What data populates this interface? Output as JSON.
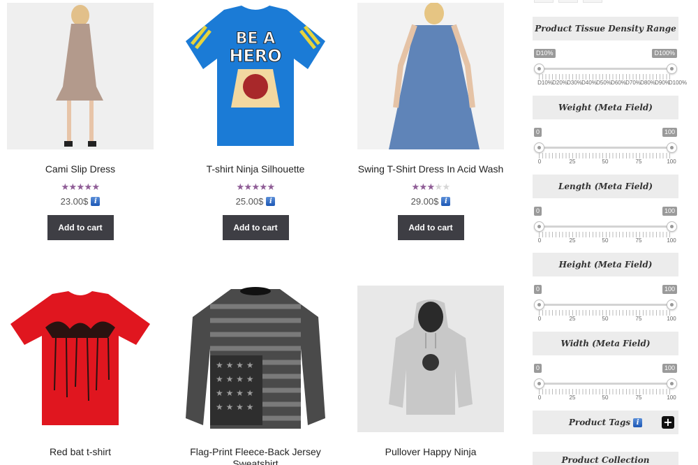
{
  "products": [
    {
      "title": "Cami Slip Dress",
      "rating": 5,
      "price": "23.00$",
      "button": "Add to cart"
    },
    {
      "title": "T-shirt Ninja Silhouette",
      "rating": 5,
      "price": "25.00$",
      "button": "Add to cart"
    },
    {
      "title": "Swing T-Shirt Dress In Acid Wash",
      "rating": 3,
      "price": "29.00$",
      "button": "Add to cart"
    },
    {
      "title": "Red bat t-shirt"
    },
    {
      "title": "Flag-Print Fleece-Back Jersey Sweatshirt"
    },
    {
      "title": "Pullover Happy Ninja"
    }
  ],
  "tshirt_print": {
    "line1": "BE A",
    "line2": "HERO"
  },
  "info_icon": {
    "glyph": "i",
    "icon": "info-icon"
  },
  "sidebar": {
    "density": {
      "title": "Product Tissue Density Range",
      "min_label": "D10%",
      "max_label": "D100%",
      "ticks": [
        "D10%",
        "D20%",
        "D30%",
        "D40%",
        "D50%",
        "D60%",
        "D70%",
        "D80%",
        "D90%",
        "D100%"
      ]
    },
    "weight": {
      "title": "Weight (Meta Field)",
      "min_label": "0",
      "max_label": "100",
      "ticks": [
        "0",
        "25",
        "50",
        "75",
        "100"
      ]
    },
    "length": {
      "title": "Length (Meta Field)",
      "min_label": "0",
      "max_label": "100",
      "ticks": [
        "0",
        "25",
        "50",
        "75",
        "100"
      ]
    },
    "height": {
      "title": "Height (Meta Field)",
      "min_label": "0",
      "max_label": "100",
      "ticks": [
        "0",
        "25",
        "50",
        "75",
        "100"
      ]
    },
    "width": {
      "title": "Width (Meta Field)",
      "min_label": "0",
      "max_label": "100",
      "ticks": [
        "0",
        "25",
        "50",
        "75",
        "100"
      ]
    },
    "tags": {
      "title": "Product Tags",
      "plus": "+"
    },
    "collection": {
      "title": "Product Collection"
    }
  },
  "colors": {
    "accent_star": "#8f5d96",
    "button_bg": "#3e3e44",
    "header_bg": "#ececec"
  }
}
